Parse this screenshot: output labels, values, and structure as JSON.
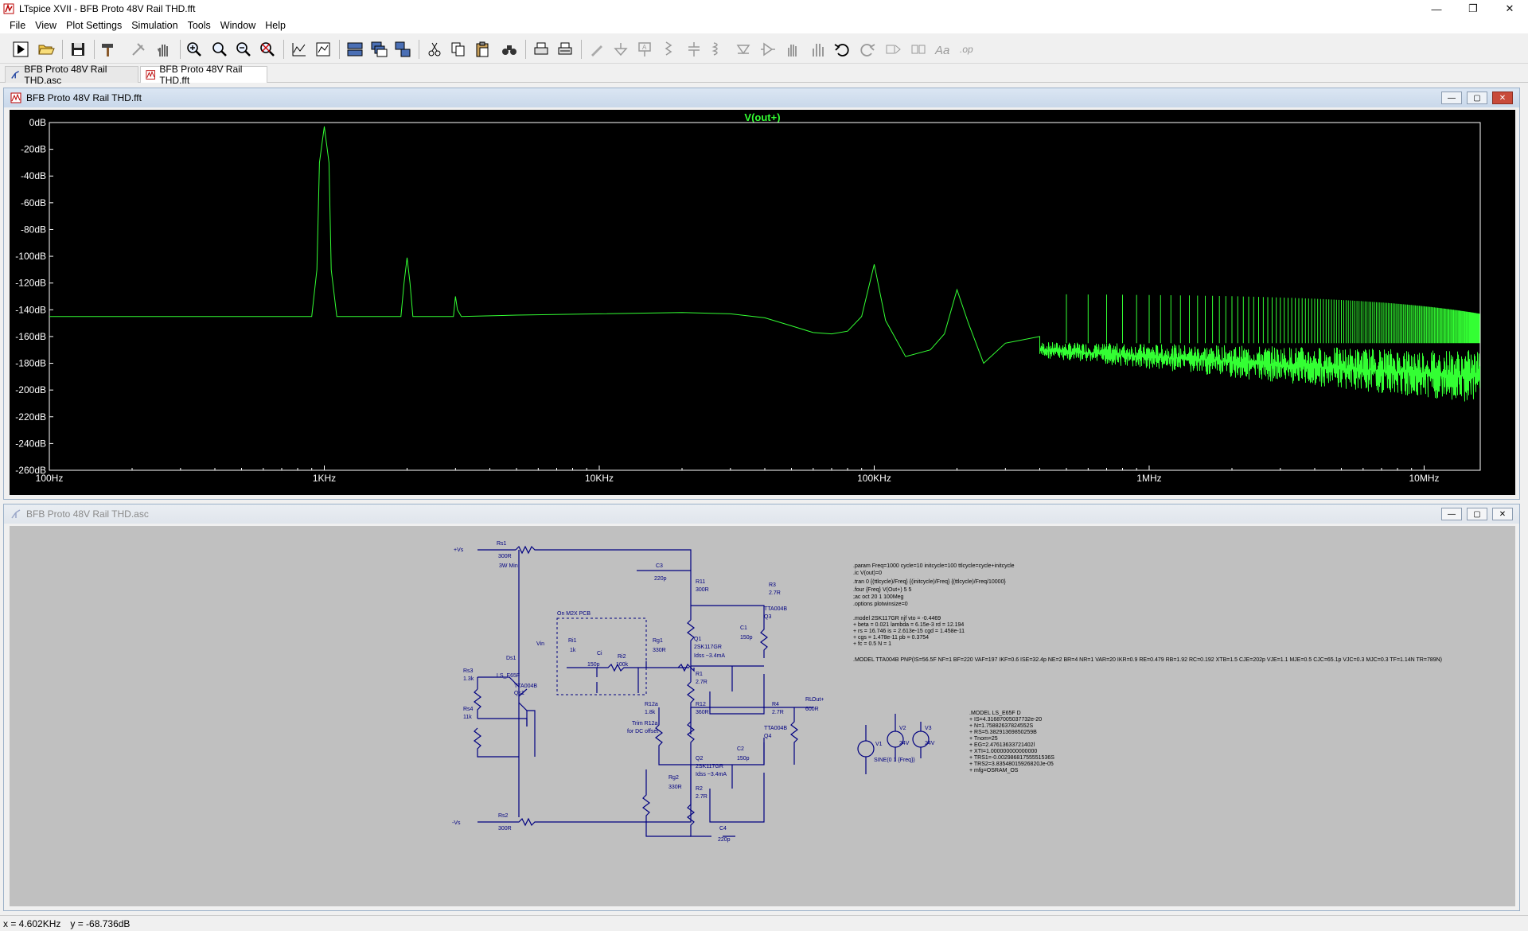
{
  "window": {
    "title": "LTspice XVII - BFB Proto 48V Rail THD.fft"
  },
  "menu": [
    "File",
    "View",
    "Plot Settings",
    "Simulation",
    "Tools",
    "Window",
    "Help"
  ],
  "tabs": [
    {
      "label": "BFB Proto 48V Rail THD.asc"
    },
    {
      "label": "BFB Proto 48V Rail THD.fft"
    }
  ],
  "plot_window": {
    "title": "BFB Proto 48V Rail THD.fft"
  },
  "schematic_window": {
    "title": "BFB Proto 48V Rail THD.asc"
  },
  "colors": {
    "trace": "#33ff33",
    "plot_bg": "#000000",
    "schematic_bg": "#c0c0c0",
    "wire": "#000080",
    "net_text": "#000080"
  },
  "chart_data": {
    "type": "line",
    "title": "V(out+)",
    "xscale": "log",
    "xlim": [
      100,
      16000000
    ],
    "ylim": [
      -260,
      0
    ],
    "grid": false,
    "x_tick_labels": [
      "100Hz",
      "1KHz",
      "10KHz",
      "100KHz",
      "1MHz",
      "10MHz"
    ],
    "x_ticks": [
      100,
      1000,
      10000,
      100000,
      1000000,
      10000000
    ],
    "y_tick_labels": [
      "0dB",
      "-20dB",
      "-40dB",
      "-60dB",
      "-80dB",
      "-100dB",
      "-120dB",
      "-140dB",
      "-160dB",
      "-180dB",
      "-200dB",
      "-220dB",
      "-240dB",
      "-260dB"
    ],
    "y_ticks": [
      0,
      -20,
      -40,
      -60,
      -80,
      -100,
      -120,
      -140,
      -160,
      -180,
      -200,
      -220,
      -240,
      -260
    ],
    "series": [
      {
        "name": "V(out+)",
        "points": [
          [
            100,
            -145
          ],
          [
            900,
            -145
          ],
          [
            940,
            -110
          ],
          [
            960,
            -30
          ],
          [
            1000,
            -3
          ],
          [
            1040,
            -30
          ],
          [
            1060,
            -110
          ],
          [
            1110,
            -145
          ],
          [
            1900,
            -145
          ],
          [
            1950,
            -120
          ],
          [
            2000,
            -101
          ],
          [
            2050,
            -120
          ],
          [
            2100,
            -145
          ],
          [
            2950,
            -145
          ],
          [
            3000,
            -130
          ],
          [
            3050,
            -140
          ],
          [
            3150,
            -145
          ],
          [
            5000,
            -144
          ],
          [
            10000,
            -143
          ],
          [
            20000,
            -142
          ],
          [
            30000,
            -143
          ],
          [
            40000,
            -146
          ],
          [
            50000,
            -152
          ],
          [
            60000,
            -157
          ],
          [
            70000,
            -158
          ],
          [
            80000,
            -156
          ],
          [
            90000,
            -145
          ],
          [
            100000,
            -106
          ],
          [
            110000,
            -148
          ],
          [
            130000,
            -175
          ],
          [
            160000,
            -170
          ],
          [
            180000,
            -158
          ],
          [
            200000,
            -125
          ],
          [
            220000,
            -150
          ],
          [
            250000,
            -180
          ],
          [
            300000,
            -165
          ],
          [
            400000,
            -160
          ]
        ],
        "noise_floor": {
          "from": 400000,
          "to": 16000000,
          "center_db": [
            -170,
            -190
          ],
          "spread_db": 40,
          "spurs_db": -128
        }
      }
    ]
  },
  "schematic": {
    "labels": [
      "+Vs",
      "Rs1",
      "300R",
      "3W Min",
      "-Vs",
      "Rs2",
      "300R",
      "Rs3",
      "1.3k",
      "Rs4",
      "11k",
      "Ds1",
      "LS_E65F",
      "TTA004B",
      "Qs1",
      "On M2X PCB",
      "Vin",
      "Ri1",
      "1k",
      "Ci",
      "150p",
      "Ri2",
      "100k",
      "Rg1",
      "330R",
      "Q1",
      "2SK117GR",
      "Idss ~3.4mA",
      "C3",
      "220p",
      "R11",
      "300R",
      "R3",
      "2.7R",
      "TTA004B",
      "Q3",
      "C1",
      "150p",
      "R1",
      "2.7R",
      "Out+",
      "R12a",
      "1.8k",
      "R12",
      "360R",
      "R4",
      "2.7R",
      "RL",
      "600R",
      "Trim R12a",
      "for DC offset",
      "TTA004B",
      "Q4",
      "C2",
      "150p",
      "Q2",
      "2SK117GR",
      "Idss ~3.4mA",
      "Rg2",
      "330R",
      "R2",
      "2.7R",
      "C4",
      "220p",
      "V1",
      "SINE(0 1 {Freq})",
      "V2",
      "24V",
      "V3",
      "24V"
    ],
    "directives": [
      ".param Freq=1000 cycle=10 initcycle=100 ttlcycle=cycle+initcycle",
      ".ic V(out)=0",
      ".tran 0 {(ttlcycle)/Freq} {(initcycle)/Freq} {(ttlcycle)/Freq/10000}",
      ".four {Freq} V(Out+) 5 5",
      ";ac oct 20 1 100Meg",
      ".options plotwinsize=0",
      ".model 2SK117GR njf vto = -0.4469",
      "+ beta = 0.021 lambda = 6.15e-3 rd = 12.194",
      "+ rs = 16.746 is = 2.613e-15 cgd = 1.458e-11",
      "+ cgs = 1.478e-11 pb = 0.3754",
      "+ fc = 0.5 N = 1",
      ".MODEL TTA004B PNP(IS=56.5F NF=1 BF=220 VAF=197 IKF=0.6 ISE=32.4p NE=2  BR=4 NR=1 VAR=20 IKR=0.9 RE=0.479 RB=1.92 RC=0.192 XTB=1.5  CJE=202p VJE=1.1 MJE=0.5 CJC=65.1p VJC=0.3 MJC=0.3 TF=1.14N TR=789N)",
      ".MODEL LS_E65F D",
      "+ IS=4.31687005037732e-20",
      "+ N=1.75882637824552S",
      "+ RS=5.38291369850259B",
      "+ Tnom=25",
      "+ EG=2.47613633721402l",
      "+ XTI=1.000000000000000",
      "+ TRS1=-0.00298681755551536S",
      "+ TRS2=3.83548015926820Je-05",
      "+ mfg=OSRAM_OS"
    ]
  },
  "status": {
    "x": "x = 4.602KHz",
    "y": "y = -68.736dB"
  }
}
